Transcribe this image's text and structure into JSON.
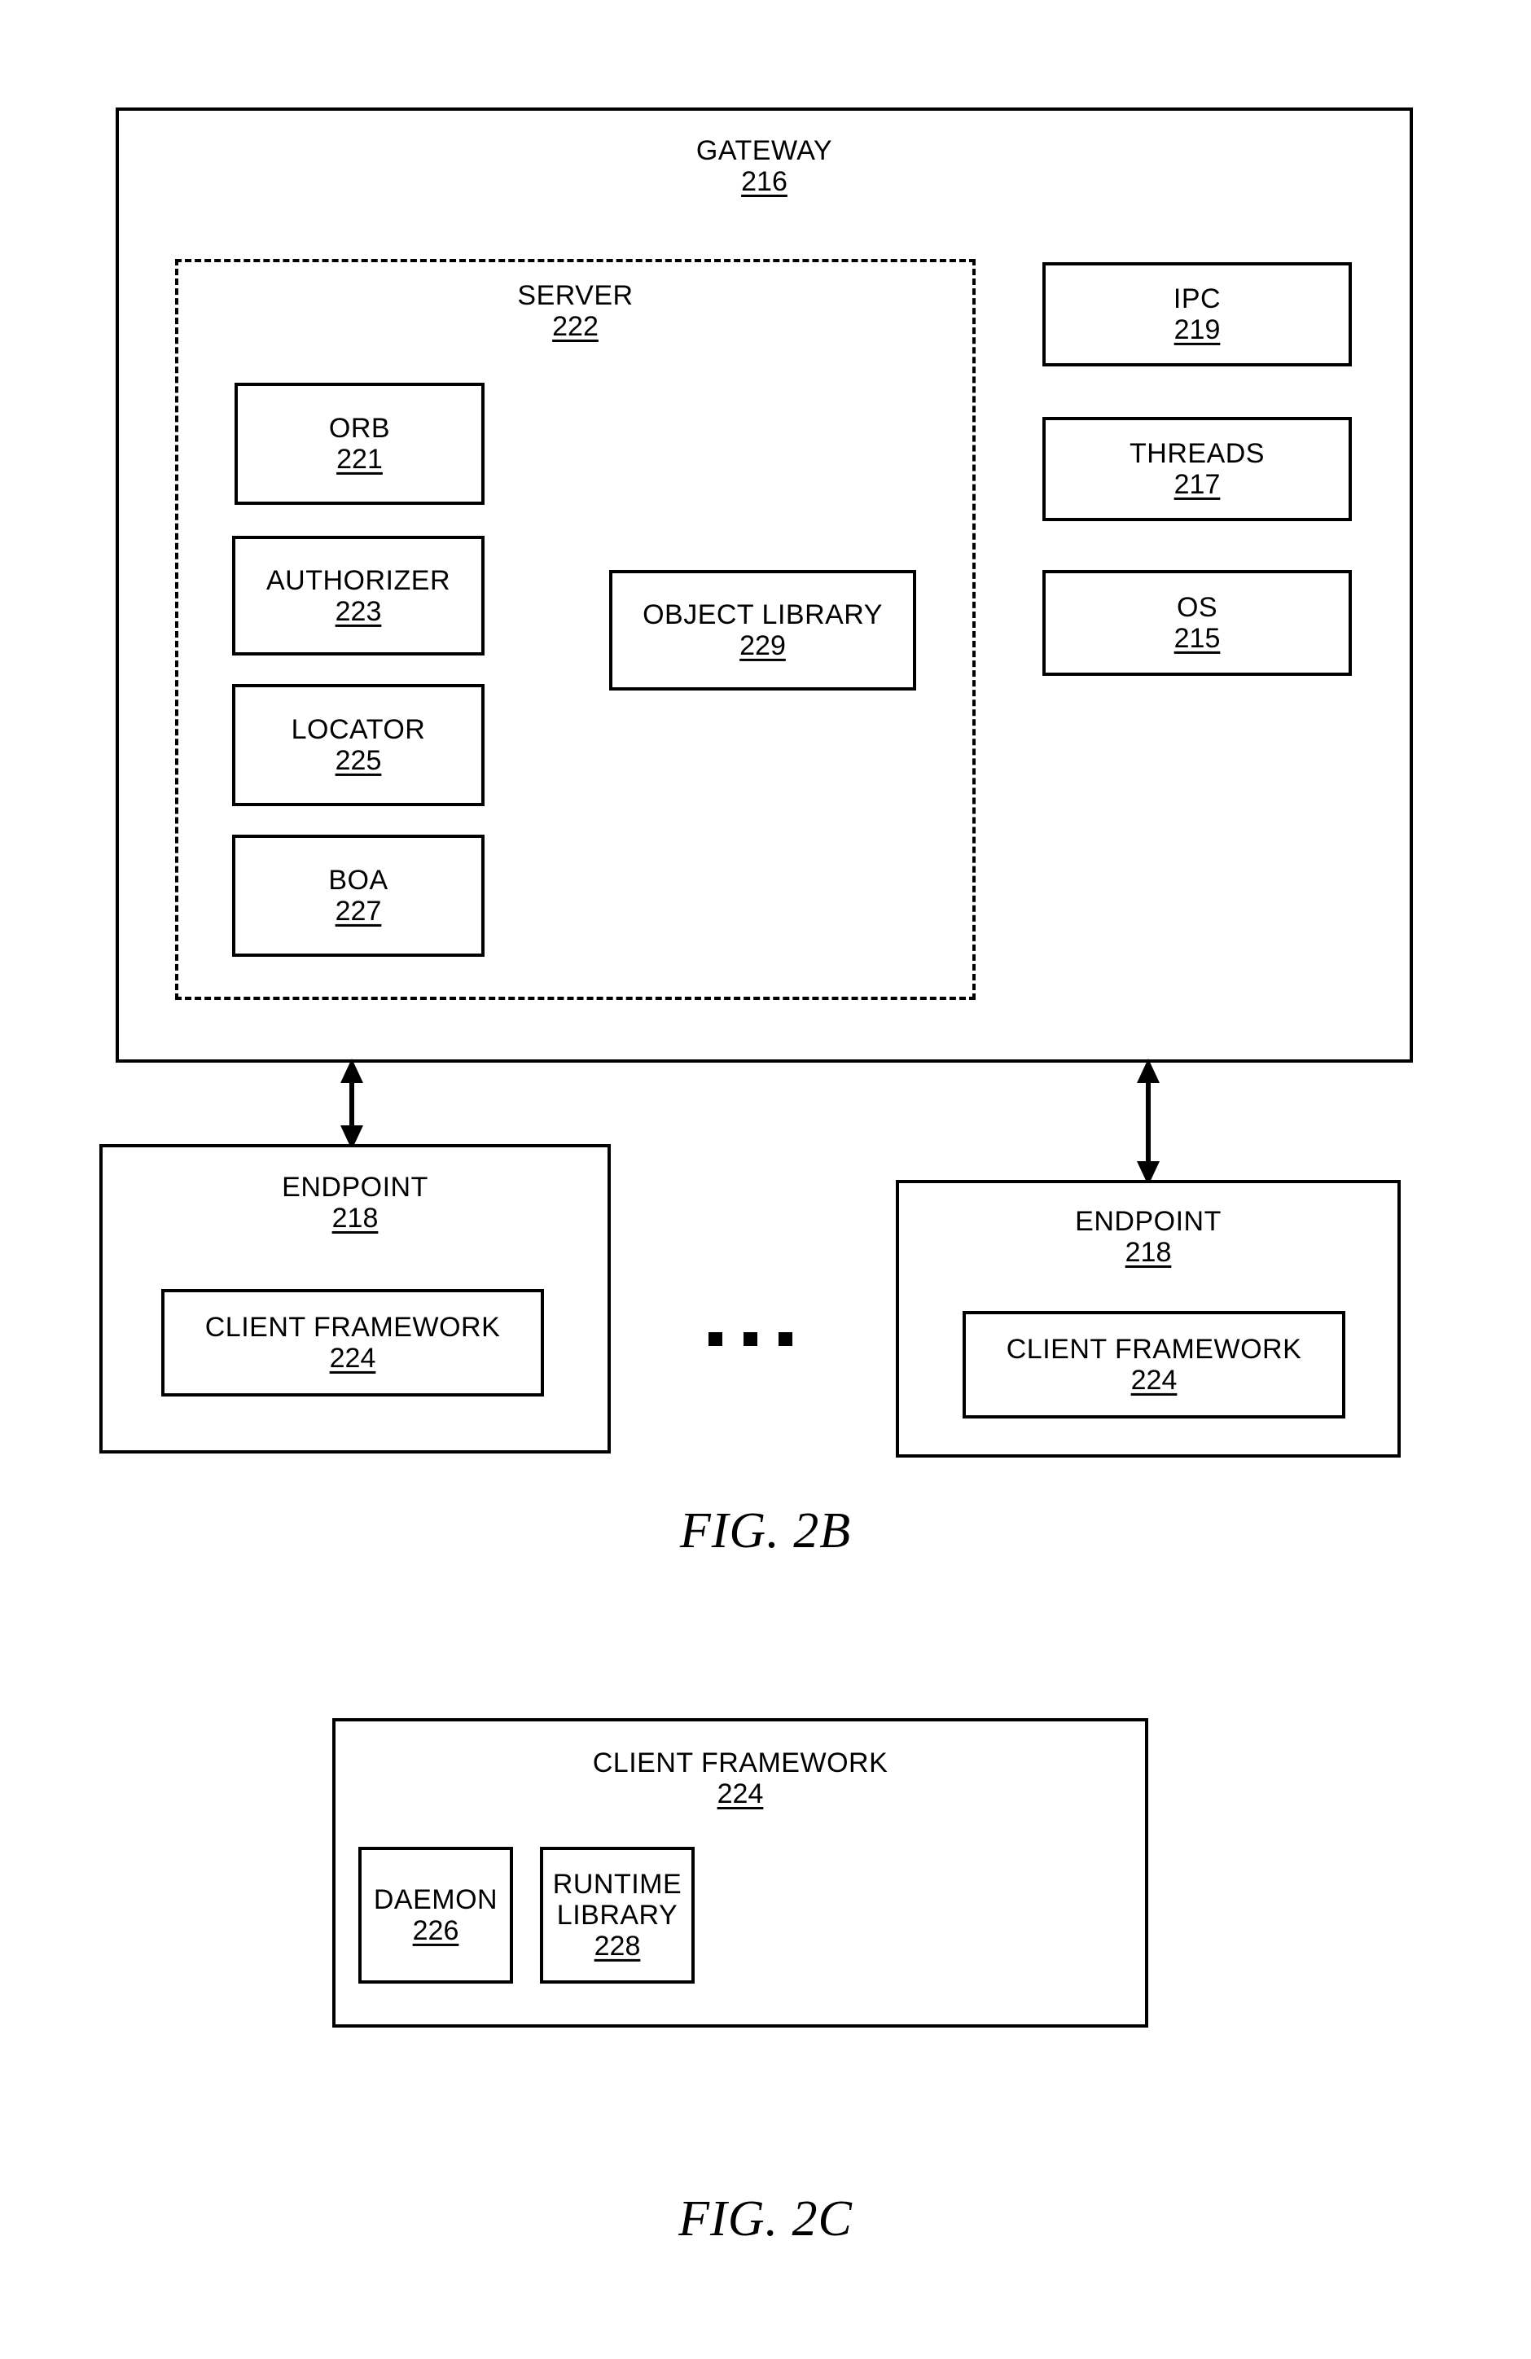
{
  "figures": [
    {
      "caption": "FIG. 2B",
      "gateway": {
        "label": "GATEWAY",
        "num": "216"
      },
      "server": {
        "label": "SERVER",
        "num": "222"
      },
      "server_components": [
        {
          "label": "ORB",
          "num": "221"
        },
        {
          "label": "AUTHORIZER",
          "num": "223"
        },
        {
          "label": "LOCATOR",
          "num": "225"
        },
        {
          "label": "BOA",
          "num": "227"
        }
      ],
      "object_library": {
        "label": "OBJECT LIBRARY",
        "num": "229"
      },
      "system_services": [
        {
          "label": "IPC",
          "num": "219"
        },
        {
          "label": "THREADS",
          "num": "217"
        },
        {
          "label": "OS",
          "num": "215"
        }
      ],
      "endpoints": [
        {
          "label": "ENDPOINT",
          "num": "218",
          "client_framework": {
            "label": "CLIENT FRAMEWORK",
            "num": "224"
          }
        },
        {
          "label": "ENDPOINT",
          "num": "218",
          "client_framework": {
            "label": "CLIENT FRAMEWORK",
            "num": "224"
          }
        }
      ],
      "continuation_marker": "• • •"
    },
    {
      "caption": "FIG. 2C",
      "client_framework": {
        "label": "CLIENT FRAMEWORK",
        "num": "224"
      },
      "components": [
        {
          "label": "DAEMON",
          "num": "226"
        },
        {
          "label": "RUNTIME LIBRARY",
          "label_line1": "RUNTIME",
          "label_line2": "LIBRARY",
          "num": "228"
        }
      ]
    }
  ],
  "colors": {
    "ink": "#000000",
    "paper": "#ffffff"
  }
}
